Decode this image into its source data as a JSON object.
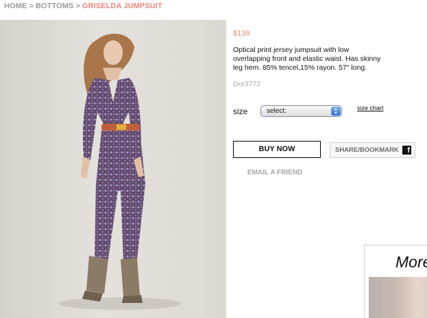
{
  "breadcrumb": {
    "items": [
      "HOME",
      "BOTTOMS"
    ],
    "separator": ">",
    "current": "GRISELDA JUMPSUIT"
  },
  "product": {
    "price": "$139",
    "description": "Optical print jersey jumpsuit with low overlapping front and elastic waist. Has skinny leg hem. 85% tencel,15% rayon. 57\" long.",
    "sku": "Dre3772"
  },
  "size": {
    "label": "size",
    "selected": "select:",
    "chart_link": "size chart"
  },
  "actions": {
    "buy_now": "BUY NOW",
    "share": "SHARE/BOOKMARK",
    "share_icon": "f",
    "email_friend": "EMAIL A FRIEND"
  },
  "more": {
    "title": "More"
  },
  "colors": {
    "accent": "#e8877c",
    "muted_text": "#9a9a9a"
  }
}
